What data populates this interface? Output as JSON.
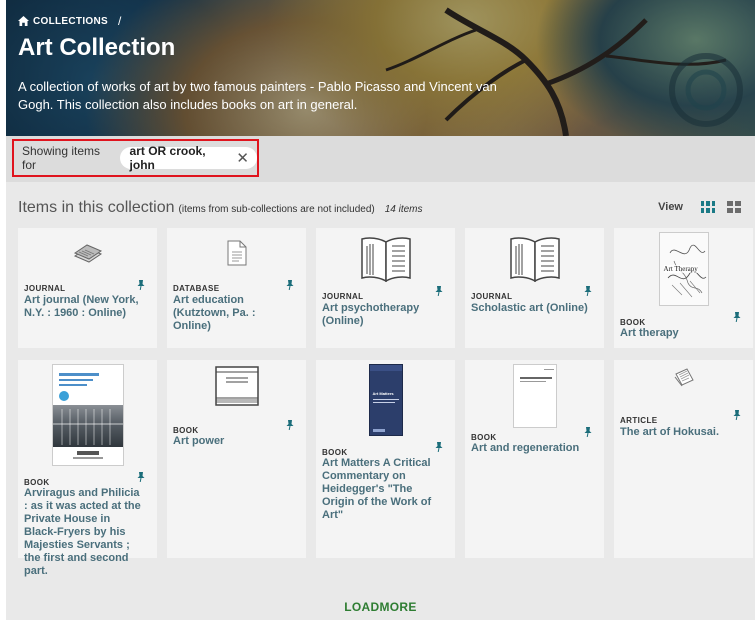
{
  "breadcrumb": {
    "label": "COLLECTIONS",
    "separator": "/"
  },
  "collection": {
    "title": "Art Collection",
    "description": "A collection of works of art by two famous painters - Pablo Picasso and Vincent van Gogh. This collection also includes books on art in general."
  },
  "filter": {
    "label": "Showing items for",
    "query": "art OR crook, john",
    "close_glyph": "✕"
  },
  "heading": {
    "title": "Items in this collection",
    "note": "(items from sub-collections are not included)",
    "count": "14 items"
  },
  "view": {
    "label": "View"
  },
  "items": [
    {
      "type": "JOURNAL",
      "title": "Art journal (New York, N.Y. : 1960 : Online)",
      "icon": "journal-stack-icon"
    },
    {
      "type": "DATABASE",
      "title": "Art education (Kutztown, Pa. : Online)",
      "icon": "document-icon"
    },
    {
      "type": "JOURNAL",
      "title": "Art psychotherapy (Online)",
      "icon": "open-book-icon"
    },
    {
      "type": "JOURNAL",
      "title": "Scholastic art (Online)",
      "icon": "open-book-icon"
    },
    {
      "type": "BOOK",
      "title": "Art therapy",
      "icon": "book-cover-art-therapy"
    },
    {
      "type": "BOOK",
      "title": "Arviragus and Philicia : as it was acted at the Private House in Black-Fryers by his Majesties Servants ; the first and second part.",
      "icon": "book-cover-building"
    },
    {
      "type": "BOOK",
      "title": "Art power",
      "icon": "closed-book-icon"
    },
    {
      "type": "BOOK",
      "title": "Art Matters A Critical Commentary on Heidegger's \"The Origin of the Work of Art\"",
      "icon": "book-cover-art-matters"
    },
    {
      "type": "BOOK",
      "title": "Art and regeneration",
      "icon": "book-cover-plain"
    },
    {
      "type": "ARTICLE",
      "title": "The art of Hokusai.",
      "icon": "article-icon"
    }
  ],
  "load_more": "LOADMORE",
  "thumb_text": {
    "art_therapy": "Art Therapy",
    "art_matters": "Art Matters"
  },
  "colors": {
    "accent": "#1b7a86",
    "title_link": "#4a6f7c",
    "highlight_border": "#e0141e",
    "load_more": "#2e7d32"
  }
}
